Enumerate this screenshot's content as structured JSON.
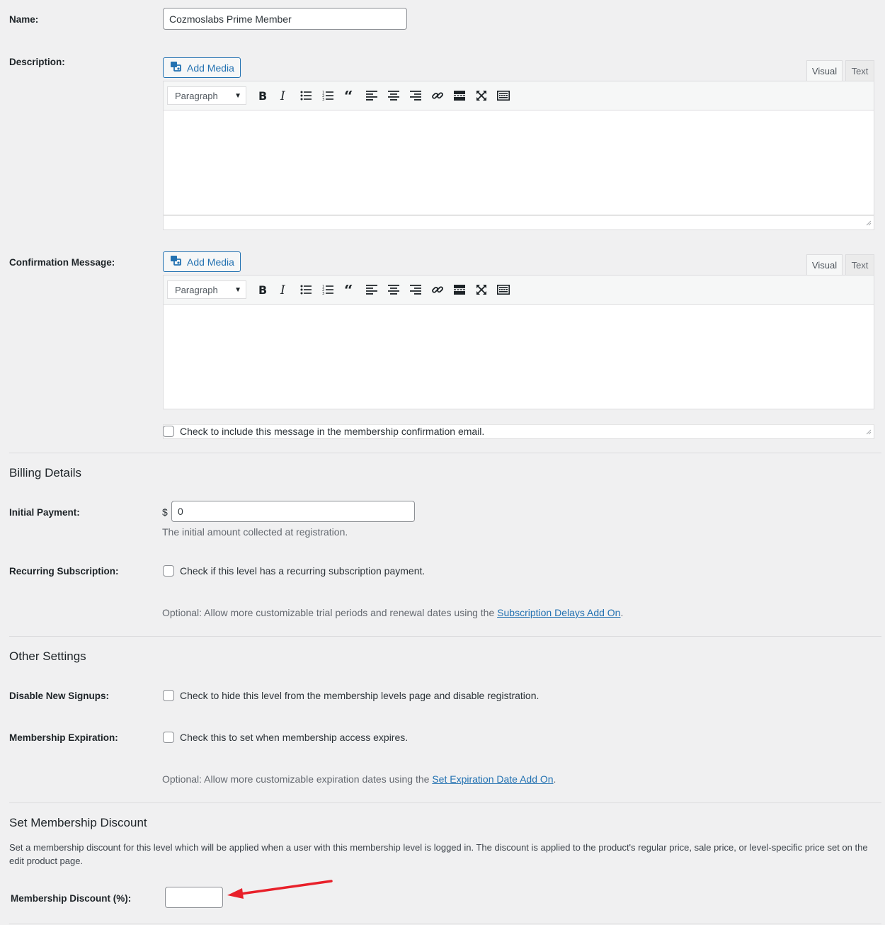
{
  "name_field": {
    "label": "Name:",
    "value": "Cozmoslabs Prime Member"
  },
  "description": {
    "label": "Description:",
    "add_media": "Add Media",
    "tab_visual": "Visual",
    "tab_text": "Text",
    "format": "Paragraph"
  },
  "confirmation": {
    "label": "Confirmation Message:",
    "add_media": "Add Media",
    "tab_visual": "Visual",
    "tab_text": "Text",
    "format": "Paragraph",
    "email_checkbox": "Check to include this message in the membership confirmation email."
  },
  "billing": {
    "title": "Billing Details",
    "initial_label": "Initial Payment:",
    "currency": "$",
    "initial_value": "0",
    "initial_hint": "The initial amount collected at registration.",
    "recurring_label": "Recurring Subscription:",
    "recurring_checkbox": "Check if this level has a recurring subscription payment.",
    "optional_prefix": "Optional: Allow more customizable trial periods and renewal dates using the ",
    "optional_link": "Subscription Delays Add On",
    "optional_suffix": "."
  },
  "other": {
    "title": "Other Settings",
    "signups_label": "Disable New Signups:",
    "signups_checkbox": "Check to hide this level from the membership levels page and disable registration.",
    "expiration_label": "Membership Expiration:",
    "expiration_checkbox": "Check this to set when membership access expires.",
    "optional_prefix": "Optional: Allow more customizable expiration dates using the ",
    "optional_link": "Set Expiration Date Add On",
    "optional_suffix": "."
  },
  "discount": {
    "title": "Set Membership Discount",
    "description": "Set a membership discount for this level which will be applied when a user with this membership level is logged in. The discount is applied to the product's regular price, sale price, or level-specific price set on the edit product page.",
    "label": "Membership Discount (%):",
    "value": ""
  },
  "toolbar_icons": [
    "bold-icon",
    "italic-icon",
    "bullet-list-icon",
    "numbered-list-icon",
    "blockquote-icon",
    "align-left-icon",
    "align-center-icon",
    "align-right-icon",
    "link-icon",
    "read-more-icon",
    "fullscreen-icon",
    "toolbar-toggle-icon"
  ],
  "colors": {
    "accent": "#2271b1",
    "annotation_arrow": "#e8202a",
    "background": "#f0f0f1"
  }
}
